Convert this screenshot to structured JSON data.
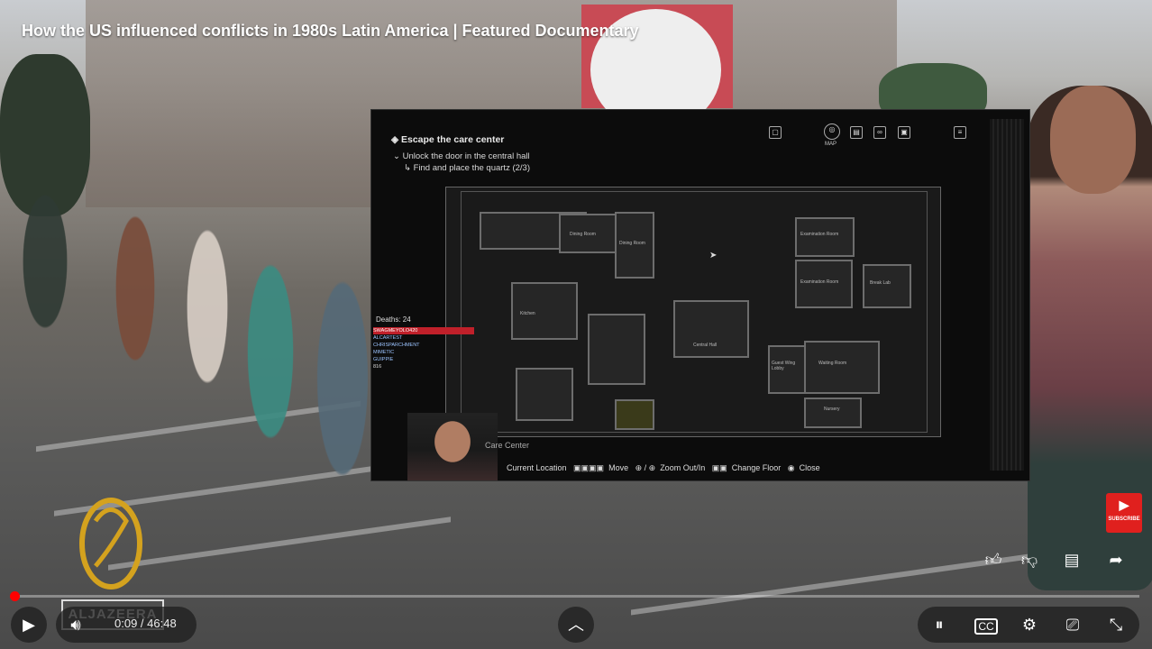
{
  "video": {
    "title": "How the US influenced conflicts in 1980s Latin America | Featured Documentary",
    "current_time": "0:09",
    "duration": "46:48",
    "time_display": "0:09 / 46:48",
    "progress_fraction": 0.0032,
    "channel_watermark": "ALJAZEERA"
  },
  "game": {
    "objective": "Escape the care center",
    "sub_objective_1": "Unlock the door in the central hall",
    "sub_objective_2": "Find and place the quartz (2/3)",
    "toolbar_map_label": "MAP",
    "deaths": "Deaths: 24",
    "chat": [
      "SWAGMEYOLO420",
      "ALCARTEST",
      "CHRISPARCHMENT",
      "MIMETIC",
      "GUIPPIE",
      "816"
    ],
    "location": "Care Center",
    "controls": [
      {
        "label": "Current Location"
      },
      {
        "label": "Move"
      },
      {
        "label": "Zoom Out/In"
      },
      {
        "label": "Change Floor"
      },
      {
        "label": "Close"
      }
    ],
    "rooms": [
      "Dining Room",
      "Dining Room",
      "Kitchen",
      "Central Hall",
      "Guest Wing Lobby",
      "Examination Room",
      "Examination Room",
      "Break Lab",
      "Waiting Room",
      "Nursery"
    ]
  },
  "icons": {
    "play": "play-icon",
    "volume": "volume-icon",
    "expand_up": "chevron-up-icon",
    "autoplay": "autoplay-toggle-icon",
    "captions": "cc-icon",
    "settings": "gear-icon",
    "cast": "cast-icon",
    "fullscreen_exit": "exit-fullscreen-icon",
    "like": "thumbs-up-icon",
    "dislike": "thumbs-down-icon",
    "comments": "comment-icon",
    "share": "share-icon",
    "subscribe": "subscribe-icon"
  },
  "colors": {
    "progress": "#ff0000",
    "subscribe": "#e0201e"
  },
  "subscribe_label": "SUBSCRIBE"
}
